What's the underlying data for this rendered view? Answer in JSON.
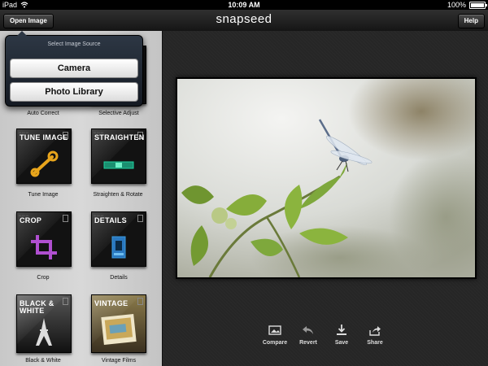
{
  "status": {
    "device": "iPad",
    "time": "10:09 AM",
    "battery": "100%",
    "battery_level": 1.0
  },
  "nav": {
    "open_button": "Open Image",
    "title": "snapseed",
    "help_button": "Help"
  },
  "popover": {
    "title": "Select Image Source",
    "options": [
      "Camera",
      "Photo Library"
    ]
  },
  "tools": [
    {
      "title": "",
      "caption": "Auto Correct",
      "icon": "auto-correct-icon"
    },
    {
      "title": "",
      "caption": "Selective Adjust",
      "icon": "selective-adjust-icon"
    },
    {
      "title": "TUNE IMAGE",
      "caption": "Tune Image",
      "icon": "wrench-icon"
    },
    {
      "title": "STRAIGHTEN",
      "caption": "Straighten & Rotate",
      "icon": "level-icon"
    },
    {
      "title": "CROP",
      "caption": "Crop",
      "icon": "crop-icon"
    },
    {
      "title": "DETAILS",
      "caption": "Details",
      "icon": "details-icon"
    },
    {
      "title": "BLACK & WHITE",
      "caption": "Black & White",
      "icon": "eiffel-tower-icon"
    },
    {
      "title": "VINTAGE",
      "caption": "Vintage Films",
      "icon": "vintage-photo-icon"
    }
  ],
  "toolbar": [
    {
      "label": "Compare",
      "icon": "compare-icon"
    },
    {
      "label": "Revert",
      "icon": "revert-icon"
    },
    {
      "label": "Save",
      "icon": "save-icon"
    },
    {
      "label": "Share",
      "icon": "share-icon"
    }
  ],
  "colors": {
    "accent_wrench": "#e8a51c",
    "crop_purple": "#b04fd0",
    "level_green": "#1fd0a0",
    "details_blue": "#3b9be0"
  }
}
